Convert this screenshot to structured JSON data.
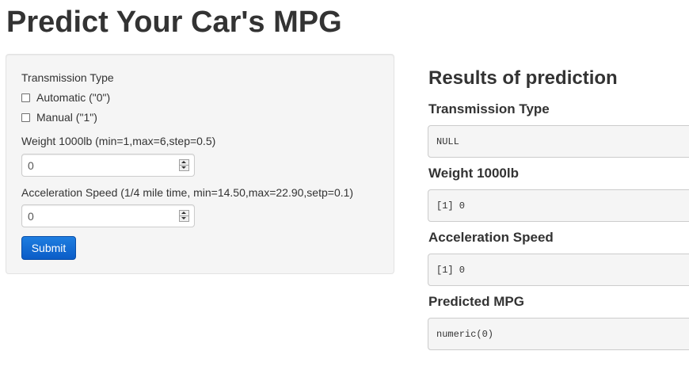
{
  "page": {
    "title": "Predict Your Car's MPG"
  },
  "sidebar": {
    "transmission": {
      "label": "Transmission Type",
      "options": [
        {
          "label": "Automatic (\"0\")",
          "checked": false
        },
        {
          "label": "Manual (\"1\")",
          "checked": false
        }
      ]
    },
    "weight": {
      "label": "Weight 1000lb (min=1,max=6,step=0.5)",
      "value": "0"
    },
    "acceleration": {
      "label": "Acceleration Speed (1/4 mile time, min=14.50,max=22.90,setp=0.1)",
      "value": "0"
    },
    "submit_label": "Submit"
  },
  "results": {
    "title": "Results of prediction",
    "items": [
      {
        "heading": "Transmission Type",
        "output": "NULL"
      },
      {
        "heading": "Weight 1000lb",
        "output": "[1] 0"
      },
      {
        "heading": "Acceleration Speed",
        "output": "[1] 0"
      },
      {
        "heading": "Predicted MPG",
        "output": "numeric(0)"
      }
    ]
  },
  "colors": {
    "button": "#0b62d1",
    "panel": "#f5f5f5"
  }
}
